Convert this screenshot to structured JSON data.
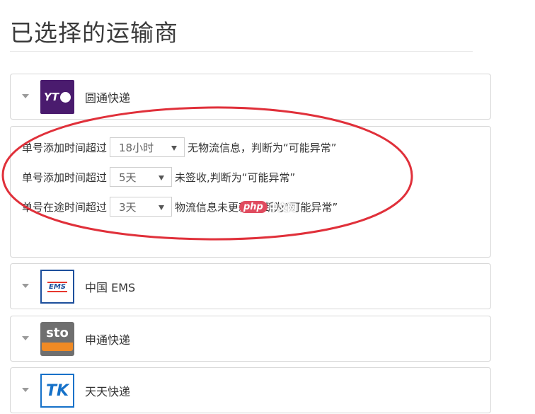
{
  "page": {
    "title": "已选择的运输商"
  },
  "carriers": [
    {
      "name": "圆通快递",
      "logo_icon": "yto-logo",
      "logo_text": "YT"
    },
    {
      "name": "中国 EMS",
      "logo_icon": "ems-logo",
      "logo_text": "EMS"
    },
    {
      "name": "申通快递",
      "logo_icon": "sto-logo",
      "logo_text": "sto"
    },
    {
      "name": "天天快递",
      "logo_icon": "tt-logo",
      "logo_text": "TK"
    }
  ],
  "rules": [
    {
      "prefix": "单号添加时间超过",
      "value": "18小时",
      "suffix": "无物流信息，判断为“可能异常”"
    },
    {
      "prefix": "单号添加时间超过",
      "value": "5天",
      "suffix": "未签收,判断为“可能异常”"
    },
    {
      "prefix": "单号在途时间超过",
      "value": "3天",
      "suffix": "物流信息未更新,判断为“可能异常”"
    }
  ],
  "annotation": {
    "color": "#e0303a"
  },
  "watermark": {
    "brand": "php",
    "text": "中文网"
  }
}
